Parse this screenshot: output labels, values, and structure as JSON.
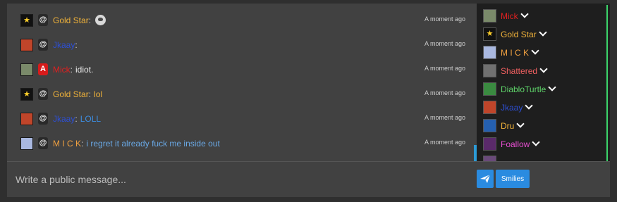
{
  "messages": [
    {
      "name": "Gold Star",
      "name_color": "#f0b23a",
      "text": "",
      "text_color": "#f0b23a",
      "badge": "@",
      "badge_type": "at",
      "avatar": "star",
      "has_smiley": true,
      "time": "A moment ago"
    },
    {
      "name": "Jkaay",
      "name_color": "#2d4fd4",
      "text": "",
      "text_color": "#2d4fd4",
      "badge": "@",
      "badge_type": "at",
      "avatar": "clown",
      "has_smiley": false,
      "time": "A moment ago"
    },
    {
      "name": "Mick",
      "name_color": "#e02020",
      "text": "idiot.",
      "text_color": "#e8e8e8",
      "badge": "A",
      "badge_type": "a",
      "avatar": "face",
      "has_smiley": false,
      "time": "A moment ago"
    },
    {
      "name": "Gold Star",
      "name_color": "#f0b23a",
      "text": "lol",
      "text_color": "#f0b23a",
      "badge": "@",
      "badge_type": "at",
      "avatar": "star",
      "has_smiley": false,
      "time": "A moment ago"
    },
    {
      "name": "Jkaay",
      "name_color": "#2d4fd4",
      "text": "LOLL",
      "text_color": "#3d8de0",
      "badge": "@",
      "badge_type": "at",
      "avatar": "clown",
      "has_smiley": false,
      "time": "A moment ago"
    },
    {
      "name": "M I C K",
      "name_color": "#f0a040",
      "text": "i regret it already fuck me inside out",
      "text_color": "#6aa9e6",
      "badge": "@",
      "badge_type": "at",
      "avatar": "anime",
      "has_smiley": false,
      "time": "A moment ago"
    }
  ],
  "users": [
    {
      "name": "Mick",
      "color": "#e02020",
      "avatar": "face"
    },
    {
      "name": "Gold Star",
      "color": "#f0b23a",
      "avatar": "star"
    },
    {
      "name": "M I C K",
      "color": "#f0a040",
      "avatar": "anime"
    },
    {
      "name": "Shattered",
      "color": "#f06060",
      "avatar": "gray"
    },
    {
      "name": "DiabloTurtle",
      "color": "#5fd46a",
      "avatar": "turtle"
    },
    {
      "name": "Jkaay",
      "color": "#2d4fd4",
      "avatar": "clown"
    },
    {
      "name": "Dru",
      "color": "#f0b23a",
      "avatar": "blue"
    },
    {
      "name": "Foallow",
      "color": "#e84fd2",
      "avatar": "purple"
    }
  ],
  "input": {
    "placeholder": "Write a public message..."
  },
  "buttons": {
    "send_icon": "paper-plane-icon",
    "smilies_label": "Smilies"
  },
  "colors": {
    "accent": "#2a8be0",
    "sidebar_border": "#3bd46a",
    "panel": "#414141",
    "sidebar_bg": "#1e1e1e"
  }
}
